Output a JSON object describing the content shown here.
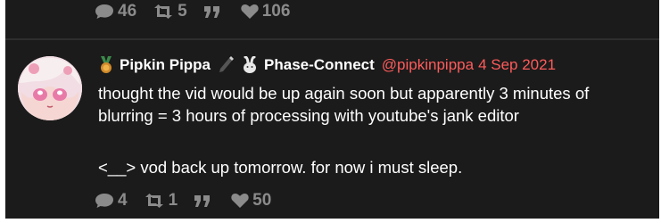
{
  "prev_post": {
    "stats": {
      "replies": "46",
      "retweets": "5",
      "quotes": "",
      "likes": "106"
    }
  },
  "post": {
    "author_name": "Pipkin Pippa",
    "group_name": "Phase-Connect",
    "handle": "@pipkinpippa",
    "date": "4 Sep 2021",
    "lines": [
      "thought the vid would be up again soon but apparently 3 minutes of",
      "blurring = 3 hours of processing with youtube's jank editor",
      "<__> vod back up tomorrow. for now i must sleep."
    ],
    "stats": {
      "replies": "4",
      "retweets": "1",
      "quotes": "",
      "likes": "50"
    }
  },
  "colors": {
    "background": "#1b1b1b",
    "text": "#ffffff",
    "handle": "#ff5b5b",
    "stat": "#8b8b8b"
  },
  "icons": [
    "reply-icon",
    "retweet-icon",
    "quote-icon",
    "heart-icon",
    "medal-icon",
    "brush-icon",
    "rabbit-icon"
  ]
}
